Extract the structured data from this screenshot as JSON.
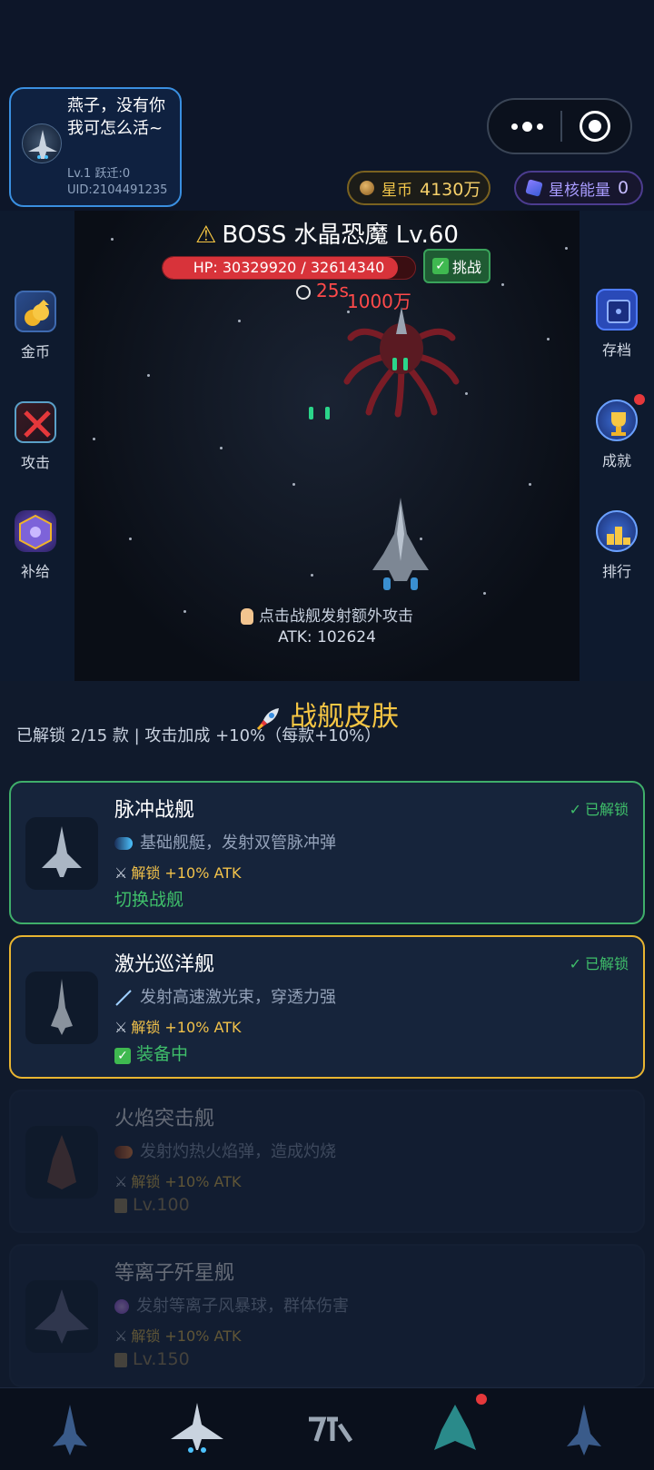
{
  "header": {
    "profile": {
      "name": "燕子，没有你我可怎么活~",
      "level_text": "Lv.1 跃迁:0",
      "uid_text": "UID:2104491235"
    },
    "coins": {
      "label": "星币",
      "value": "4130万"
    },
    "energy": {
      "label": "星核能量",
      "value": "0"
    }
  },
  "battle": {
    "boss_title": "BOSS 水晶恐魔 Lv.60",
    "boss_hp_text": "HP: 30329920 / 32614340",
    "boss_hp_fraction": 0.93,
    "challenge_label": "挑战",
    "timer_text": "25s",
    "damage_text": "1000万",
    "hint": "点击战舰发射额外攻击",
    "atk_text": "ATK: 102624",
    "left_menu": [
      {
        "label": "金币",
        "icon": "gold-coins-icon"
      },
      {
        "label": "攻击",
        "icon": "crossed-swords-icon"
      },
      {
        "label": "补给",
        "icon": "supply-crate-icon"
      }
    ],
    "right_menu": [
      {
        "label": "存档",
        "icon": "save-icon"
      },
      {
        "label": "成就",
        "icon": "trophy-icon",
        "badge": true
      },
      {
        "label": "排行",
        "icon": "leaderboard-icon"
      }
    ]
  },
  "skins": {
    "title": "战舰皮肤",
    "summary": "已解锁 2/15 款 | 攻击加成 +10%（每款+10%）",
    "cards": [
      {
        "name": "脉冲战舰",
        "status": "已解锁",
        "desc": "基础舰艇，发射双管脉冲弹",
        "bonus": "解锁 +10% ATK",
        "action": "切换战舰"
      },
      {
        "name": "激光巡洋舰",
        "status": "已解锁",
        "desc": "发射高速激光束，穿透力强",
        "bonus": "解锁 +10% ATK",
        "action": "装备中"
      },
      {
        "name": "火焰突击舰",
        "desc": "发射灼热火焰弹，造成灼烧",
        "bonus": "解锁 +10% ATK",
        "lock": "Lv.100"
      },
      {
        "name": "等离子歼星舰",
        "desc": "发射等离子风暴球，群体伤害",
        "bonus": "解锁 +10% ATK",
        "lock": "Lv.150"
      }
    ]
  },
  "bottom_nav": [
    {
      "icon": "ship-nav-icon-1"
    },
    {
      "icon": "ship-nav-icon-2",
      "selected": true
    },
    {
      "icon": "logo-nav-icon"
    },
    {
      "icon": "ship-nav-icon-4",
      "badge": true
    },
    {
      "icon": "ship-nav-icon-5"
    }
  ],
  "colors": {
    "accent_gold": "#f7c744",
    "accent_green": "#3fbf6a",
    "hp_red": "#d8333a",
    "profile_border": "#3a8fe0"
  }
}
